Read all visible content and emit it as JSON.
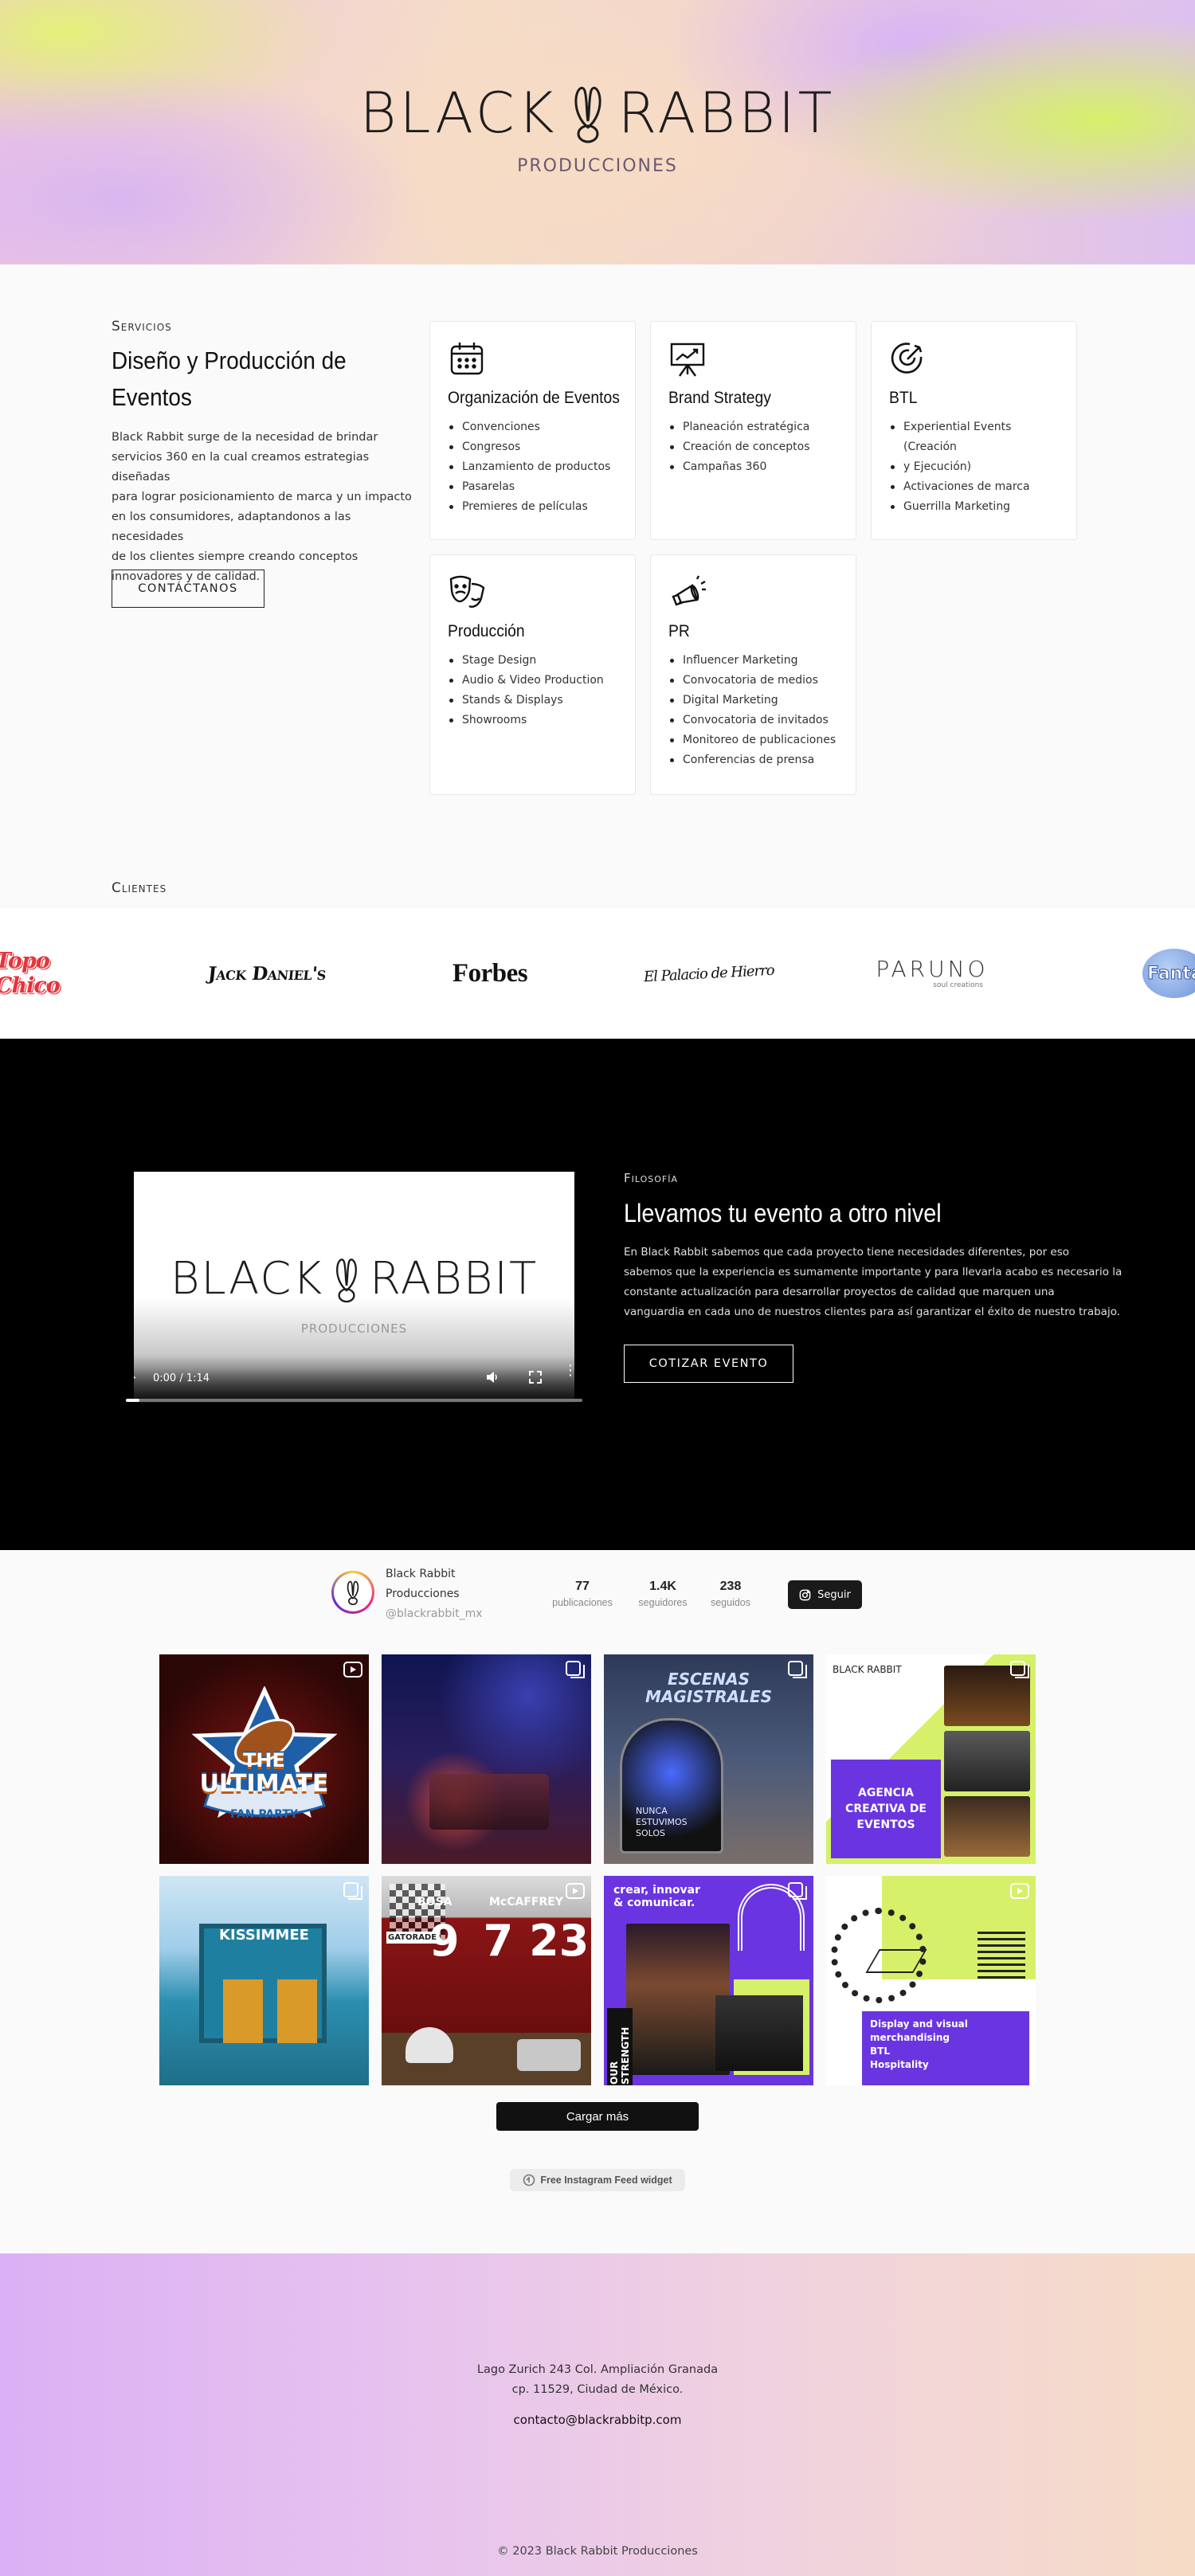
{
  "hero": {
    "brand_left": "BLACK",
    "brand_right": "RABBIT",
    "brand_sub": "PRODUCCIONES",
    "logo_icon": "rabbit-ears-icon"
  },
  "services": {
    "eyebrow": "Servicios",
    "title_line1": "Diseño y Producción de",
    "title_line2": "Eventos",
    "description_lines": [
      "Black Rabbit surge de la necesidad de brindar",
      "servicios 360 en la cual creamos estrategias diseñadas",
      "para lograr posicionamiento de marca y un impacto",
      "en los consumidores, adaptandonos a las necesidades",
      "de los clientes siempre creando conceptos",
      "innovadores y de calidad."
    ],
    "cta_label": "CONTÁCTANOS",
    "cards": [
      {
        "icon": "calendar-icon",
        "title": "Organización de Eventos",
        "items": [
          "Convenciones",
          "Congresos",
          "Lanzamiento de productos",
          "Pasarelas",
          "Premieres de películas"
        ]
      },
      {
        "icon": "presentation-board-icon",
        "title": "Brand Strategy",
        "items": [
          "Planeación estratégica",
          "Creación de conceptos",
          "Campañas 360"
        ]
      },
      {
        "icon": "target-icon",
        "title": "BTL",
        "items": [
          "Experiential Events (Creación",
          "y Ejecución)",
          "Activaciones de marca",
          "Guerrilla Marketing"
        ]
      },
      {
        "icon": "theater-masks-icon",
        "title": "Producción",
        "items": [
          "Stage Design",
          "Audio & Video Production",
          "Stands & Displays",
          "Showrooms"
        ]
      },
      {
        "icon": "megaphone-icon",
        "title": "PR",
        "items": [
          "Influencer Marketing",
          "Convocatoria de medios",
          "Digital Marketing",
          "Convocatoria de invitados",
          "Monitoreo de publicaciones",
          "Conferencias de prensa"
        ]
      }
    ]
  },
  "clients": {
    "eyebrow": "Clientes",
    "logos": [
      "Topo Chico",
      "Jack Daniel's",
      "Forbes",
      "El Palacio de Hierro",
      "PARUNO",
      "soul creations",
      "Fanta"
    ]
  },
  "philosophy": {
    "eyebrow": "Filosofía",
    "title": "Llevamos tu evento a otro nivel",
    "description_lines": [
      "En Black Rabbit sabemos que cada proyecto tiene necesidades diferentes, por eso",
      "sabemos que la experiencia es sumamente importante y para llevarla acabo es necesario la",
      "constante actualización para desarrollar proyectos de calidad que marquen una",
      "vanguardia en cada uno de nuestros clientes para así garantizar el éxito de nuestro trabajo."
    ],
    "cta_label": "COTIZAR EVENTO",
    "video": {
      "brand_left": "BLACK",
      "brand_right": "RABBIT",
      "brand_sub": "PRODUCCIONES",
      "time": "0:00 / 1:14",
      "progress": 0.03
    }
  },
  "instagram": {
    "name_line1": "Black Rabbit",
    "name_line2": "Producciones",
    "handle": "@blackrabbit_mx",
    "stats": [
      {
        "value": "77",
        "label": "publicaciones"
      },
      {
        "value": "1.4K",
        "label": "seguidores"
      },
      {
        "value": "238",
        "label": "seguidos"
      }
    ],
    "follow_label": "Seguir",
    "load_more_label": "Cargar más",
    "widget_label": "Free Instagram Feed widget",
    "posts": [
      {
        "kind": "reel",
        "text1": "THE",
        "text2": "ULTIMATE",
        "text3": "FAN PARTY"
      },
      {
        "kind": "album",
        "text1": "",
        "text2": "",
        "text3": ""
      },
      {
        "kind": "album",
        "text1": "ESCENAS",
        "text2": "MAGISTRALES",
        "text3": "NUNCA ESTUVIMOS SOLOS"
      },
      {
        "kind": "album",
        "text1": "BLACK RABBIT",
        "text2": "AGENCIA CREATIVA DE EVENTOS",
        "text3": ""
      },
      {
        "kind": "album",
        "text1": "KISSIMMEE",
        "text2": "",
        "text3": ""
      },
      {
        "kind": "reel",
        "text1": "BOSA",
        "text2": "McCAFFREY",
        "text3": "GATORADE"
      },
      {
        "kind": "album",
        "text1": "crear, innovar & comunicar.",
        "text2": "OUR STRENGTH",
        "text3": ""
      },
      {
        "kind": "reel",
        "text1": "Display and visual merchandising",
        "text2": "BTL",
        "text3": "Hospitality"
      }
    ]
  },
  "footer": {
    "address_line1": "Lago Zurich 243 Col. Ampliación Granada",
    "address_line2": "cp. 11529, Ciudad de México.",
    "email": "contacto@blackrabbitp.com",
    "copyright": "© 2023 Black Rabbit Producciones"
  },
  "colors": {
    "accent_lime": "#d6f06a",
    "accent_purple": "#6a35e0",
    "dark": "#111111"
  }
}
